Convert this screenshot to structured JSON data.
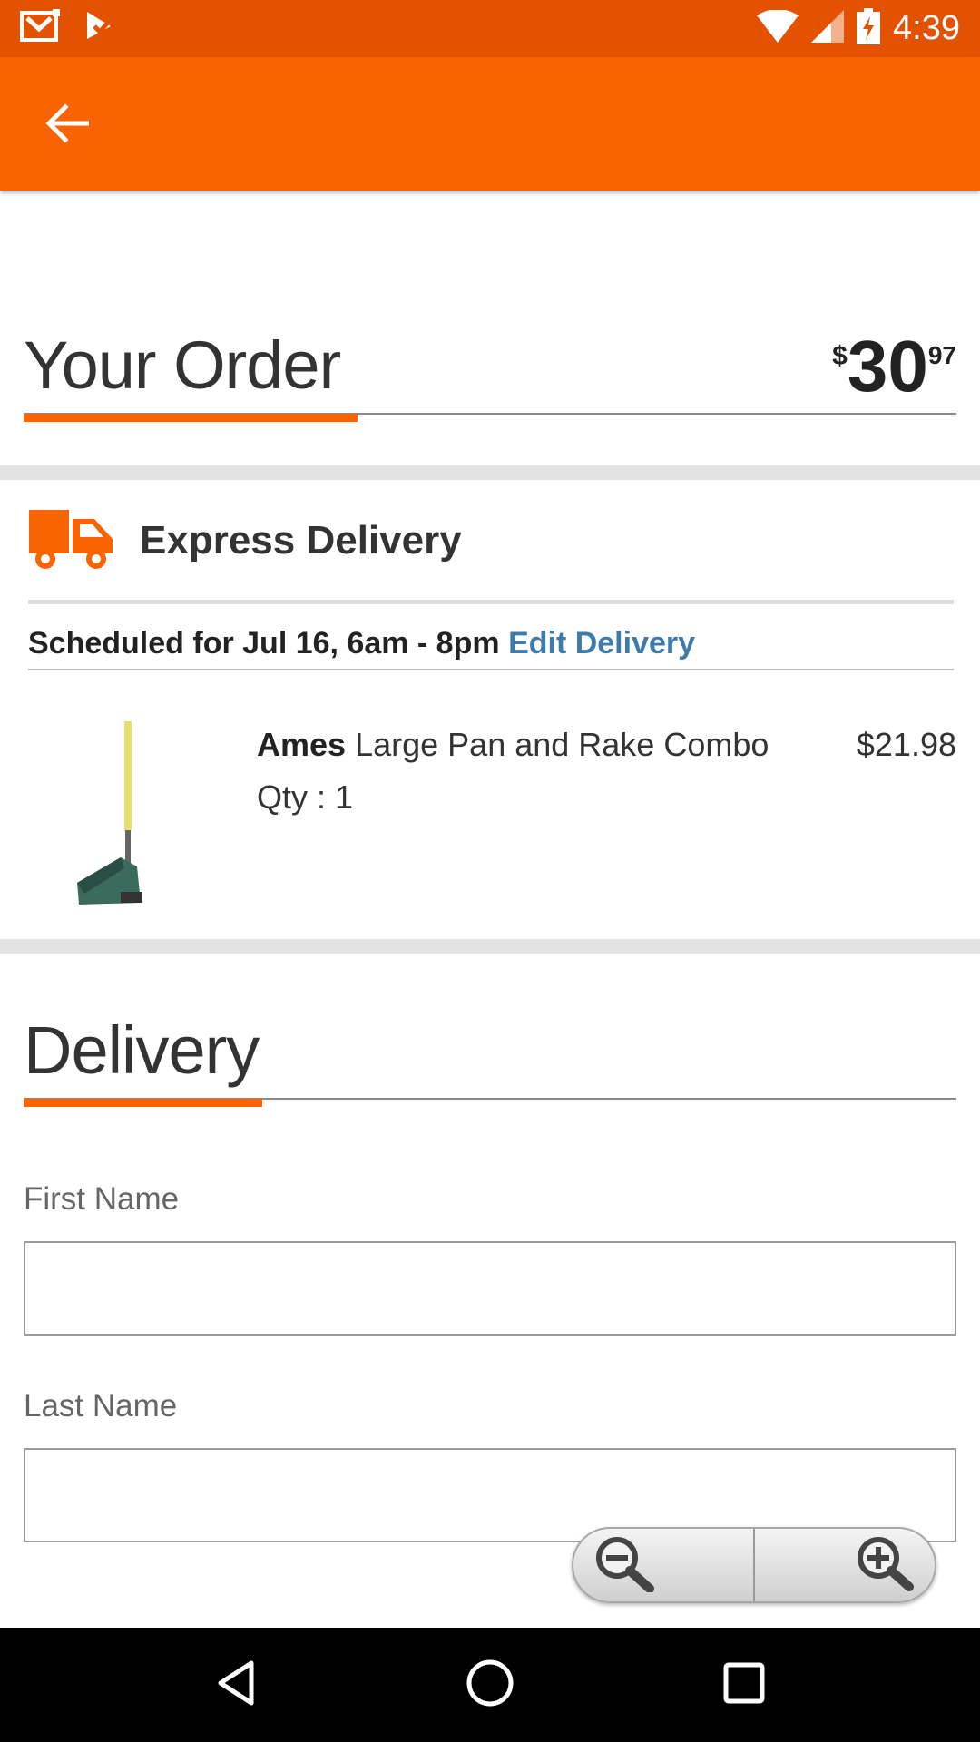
{
  "status_bar": {
    "time": "4:39",
    "icons": [
      "gmail-icon",
      "checkmark-notification-icon",
      "wifi-icon",
      "cell-signal-icon",
      "battery-charging-icon"
    ]
  },
  "app_bar": {
    "back_icon": "arrow-left-icon",
    "color": "#f96302"
  },
  "order": {
    "title": "Your Order",
    "total_currency": "$",
    "total_dollars": "30",
    "total_cents": "97"
  },
  "express": {
    "icon": "truck-icon",
    "title": "Express Delivery",
    "schedule": "Scheduled for Jul 16, 6am - 8pm",
    "edit_label": "Edit Delivery"
  },
  "product": {
    "brand": "Ames",
    "name": "Large Pan and Rake Combo",
    "qty": "Qty : 1",
    "price": "$21.98"
  },
  "delivery": {
    "title": "Delivery",
    "first_name_label": "First Name",
    "first_name_value": "",
    "last_name_label": "Last Name",
    "last_name_value": ""
  },
  "zoom": {
    "out_icon": "zoom-out-icon",
    "in_icon": "zoom-in-icon"
  },
  "nav": {
    "icons": [
      "back-triangle-icon",
      "home-circle-icon",
      "recents-square-icon"
    ]
  },
  "colors": {
    "brand_orange": "#f96302",
    "status_orange": "#e35200",
    "link_blue": "#3d7bad"
  }
}
